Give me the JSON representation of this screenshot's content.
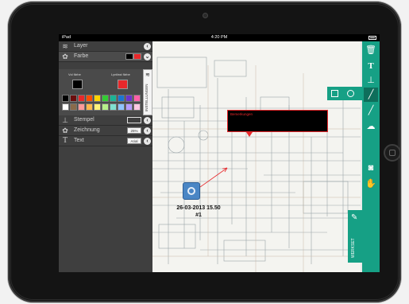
{
  "statusbar": {
    "carrier": "iPad",
    "time": "4:20 PM"
  },
  "panel": {
    "layer_label": "Layer",
    "farbe_label": "Farbe",
    "vordergrund_label": "Vol färbe",
    "hintergrund_label": "Lynifast färbe",
    "stempel_label": "Stempel",
    "zeichnung_label": "Zeichnung",
    "zeichnung_value": "25%",
    "text_label": "Text",
    "text_value": "Arial",
    "settings_tab_label": "INSTELLUNGEN",
    "colors": {
      "foreground": "#000000",
      "background": "#e8282b",
      "palette": [
        "#000000",
        "#6b0d0d",
        "#e8282b",
        "#ff4d00",
        "#ffd400",
        "#33cc33",
        "#1ab394",
        "#1a75d1",
        "#6b33cc",
        "#ff5fa8",
        "#ffffff",
        "#8a6a4a",
        "#ff9a9a",
        "#ffb84d",
        "#fff27a",
        "#b6f08a",
        "#7fe0d0",
        "#8fc3ff",
        "#b79cff",
        "#ffc8e2"
      ]
    }
  },
  "toolbar": {
    "items": [
      "trash-icon",
      "text-icon",
      "stamp-icon",
      "pen-icon",
      "brush-icon",
      "cloud-icon",
      "camera-icon",
      "hand-icon"
    ]
  },
  "shape_popup": {
    "items": [
      "rectangle-icon",
      "circle-icon"
    ]
  },
  "comment": {
    "title": "Bemerkungen"
  },
  "photo": {
    "date": "26-03-2013 15.50",
    "id": "#1"
  },
  "werkset": {
    "label": "WERKSET"
  },
  "accent": "#16a085"
}
